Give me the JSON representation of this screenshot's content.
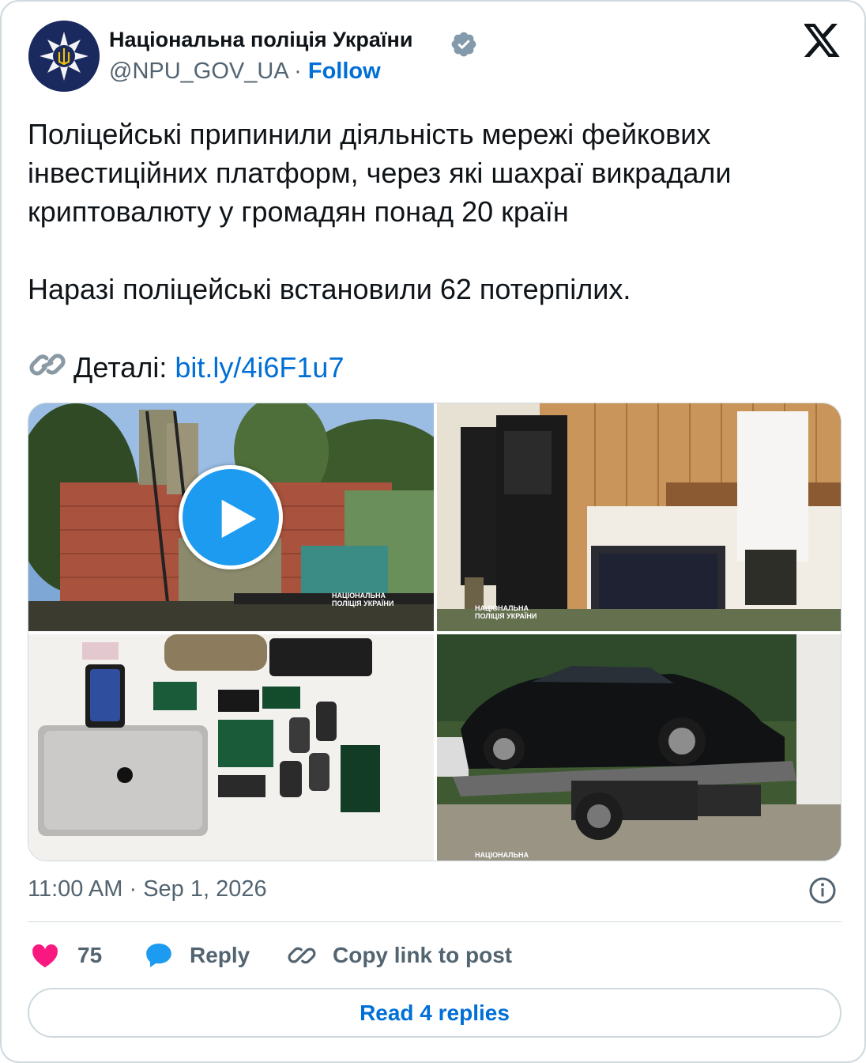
{
  "author": {
    "display_name": "Національна поліція України",
    "handle": "@NPU_GOV_UA",
    "separator": "·",
    "follow_label": "Follow",
    "verified": true,
    "avatar_icon": "police-star-emblem-icon"
  },
  "platform_logo": "x-logo-icon",
  "tweet": {
    "paragraph1": "Поліцейські припинили діяльність мережі фейкових інвестиційних платформ, через які шахраї викрадали криптовалюту у громадян понад 20 країн",
    "paragraph2": "Наразі поліцейські встановили 62 потерпілих.",
    "details_label": "Деталі:",
    "details_icon": "link-emoji-icon",
    "link_text": "bit.ly/4i6F1u7"
  },
  "media": {
    "items": [
      {
        "kind": "video",
        "watermark_line1": "НАЦІОНАЛЬНА",
        "watermark_line2": "ПОЛІЦІЯ УКРАЇНИ"
      },
      {
        "kind": "photo",
        "watermark_line1": "НАЦІОНАЛЬНА",
        "watermark_line2": "ПОЛІЦІЯ УКРАЇНИ"
      },
      {
        "kind": "photo"
      },
      {
        "kind": "photo",
        "watermark_line1": "НАЦІОНАЛЬНА"
      }
    ]
  },
  "timestamp": {
    "time": "11:00 AM",
    "separator": "·",
    "date": "Sep 1, 2026"
  },
  "actions": {
    "like_count": "75",
    "reply_label": "Reply",
    "copy_label": "Copy link to post"
  },
  "read_replies_label": "Read 4 replies",
  "colors": {
    "link_blue": "#006fd6",
    "play_blue": "#1d9bf0",
    "like_pink": "#f91880",
    "muted": "#536471",
    "border": "#cfd9de"
  }
}
